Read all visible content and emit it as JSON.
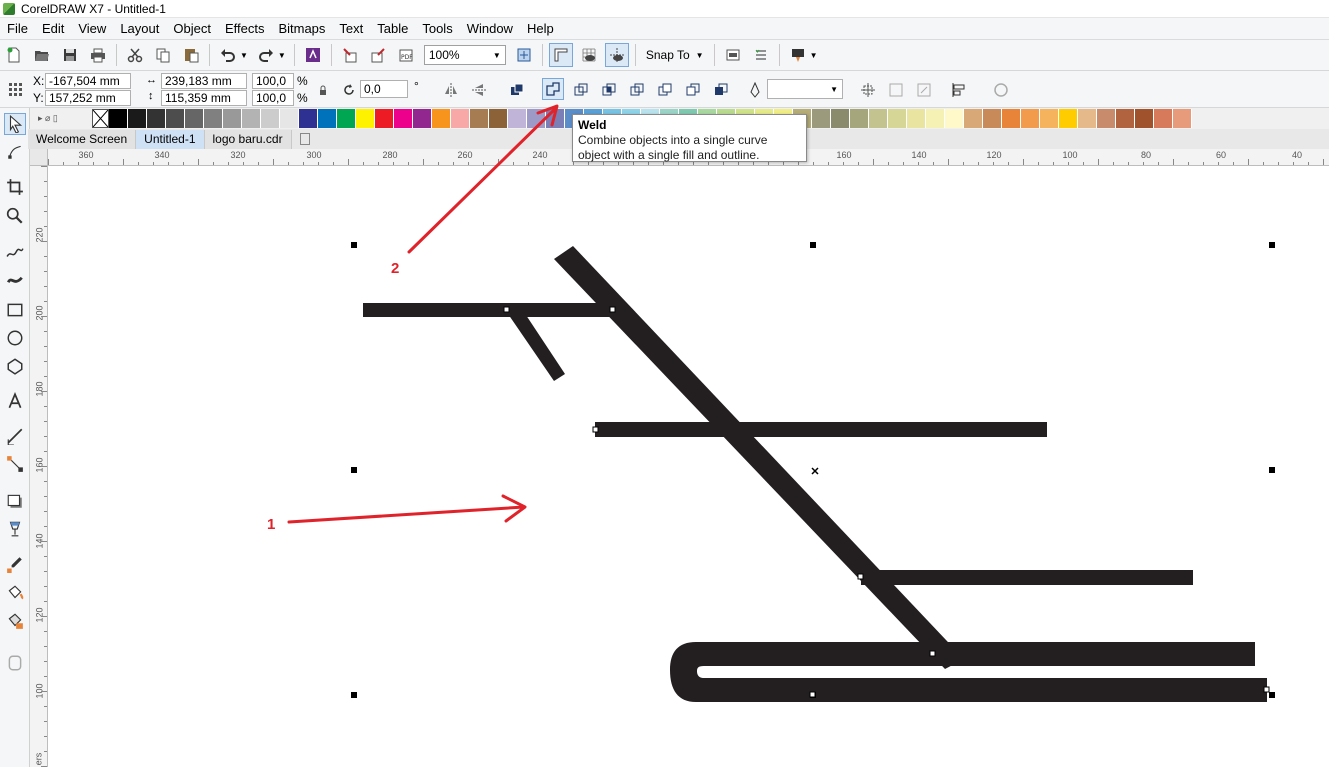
{
  "window": {
    "title": "CorelDRAW X7 - Untitled-1"
  },
  "menu": {
    "items": [
      "File",
      "Edit",
      "View",
      "Layout",
      "Object",
      "Effects",
      "Bitmaps",
      "Text",
      "Table",
      "Tools",
      "Window",
      "Help"
    ]
  },
  "toolbar": {
    "zoom_value": "100%",
    "snap_label": "Snap To"
  },
  "propertybar": {
    "x_label": "X:",
    "x_value": "-167,504 mm",
    "y_label": "Y:",
    "y_value": "157,252 mm",
    "width_value": "239,183 mm",
    "height_value": "115,359 mm",
    "scale_w": "100,0",
    "scale_h": "100,0",
    "pct": "%",
    "rotation_value": "0,0",
    "degree": "°"
  },
  "tabs": [
    {
      "label": "Welcome Screen",
      "active": false
    },
    {
      "label": "Untitled-1",
      "active": true
    },
    {
      "label": "logo baru.cdr",
      "active": false
    }
  ],
  "tooltip": {
    "title": "Weld",
    "description": "Combine objects into a single curve object with a single fill and outline."
  },
  "ruler_h": [
    "360",
    "340",
    "320",
    "300",
    "280",
    "260",
    "240",
    "160",
    "140",
    "120",
    "100",
    "80",
    "60",
    "40"
  ],
  "ruler_v": [
    "220",
    "200",
    "180",
    "160",
    "140",
    "120",
    "100"
  ],
  "ruler_v_unit": "ers",
  "annotations": {
    "one": "1",
    "two": "2",
    "color": "#e0232a"
  },
  "palette": [
    "#ffffff",
    "#000000",
    "#1a1a1a",
    "#333333",
    "#4d4d4d",
    "#666666",
    "#808080",
    "#999999",
    "#b3b3b3",
    "#cccccc",
    "#e6e6e6",
    "#2e3192",
    "#0072bc",
    "#00a651",
    "#fff200",
    "#ed1c24",
    "#ec008c",
    "#92278f",
    "#f7941d",
    "#f9a8a8",
    "#a67c52",
    "#8c6239",
    "#c0b5d9",
    "#9e9ac8",
    "#7b7fb5",
    "#5b8dc9",
    "#5aa0d6",
    "#78c2e3",
    "#8fd3e8",
    "#b8e2ed",
    "#9ad4c7",
    "#7fc9b0",
    "#a8d8a0",
    "#b9db8e",
    "#cfe28a",
    "#e4ea88",
    "#f0ed86",
    "#b5ac77",
    "#9c9a7c",
    "#8a8a6c",
    "#a6a67c",
    "#c3c38f",
    "#d6d696",
    "#e9e4a0",
    "#f5f0b4",
    "#fff9c9",
    "#d9a877",
    "#c98a5a",
    "#e8843a",
    "#f39b4c",
    "#f5b35e",
    "#ffcc00",
    "#e6b98a",
    "#c88c6c",
    "#b0633e",
    "#a0522d",
    "#d77a5c",
    "#e89b7b"
  ]
}
